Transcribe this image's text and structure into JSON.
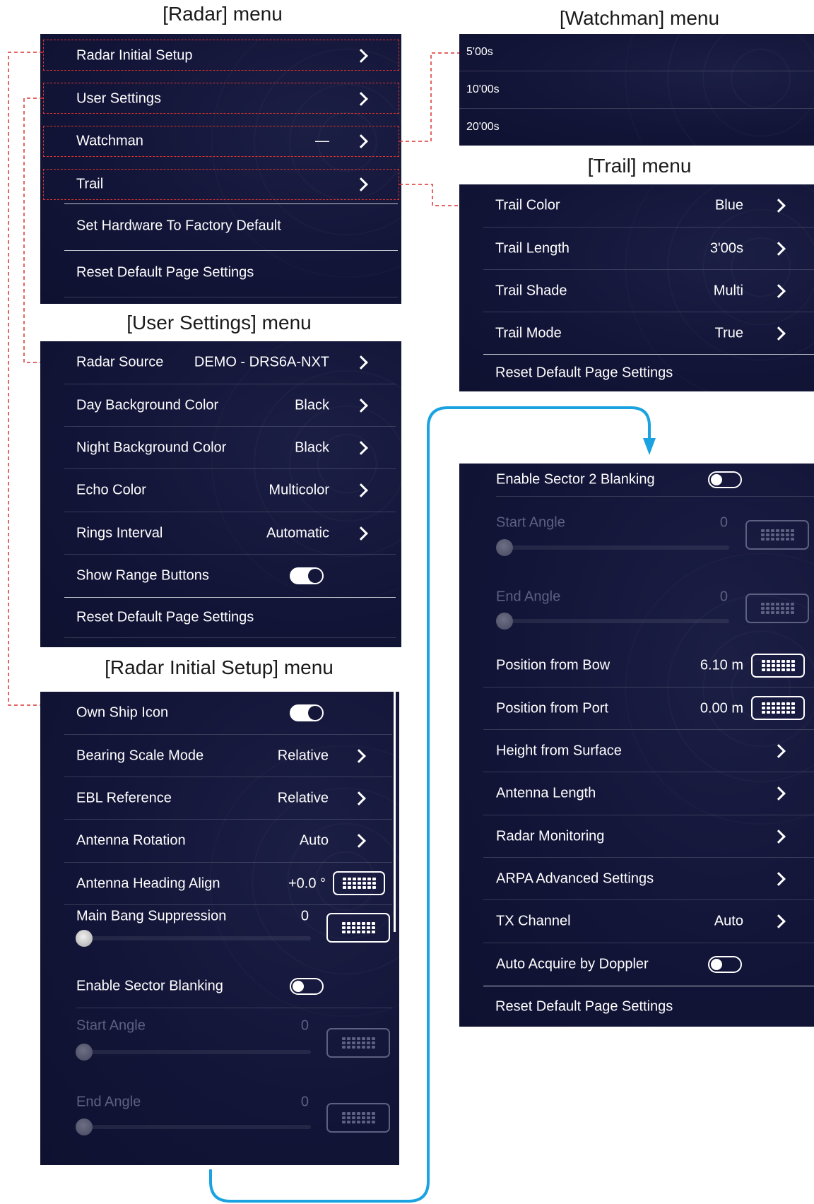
{
  "captions": {
    "radar": "[Radar] menu",
    "watchman": "[Watchman] menu",
    "trail": "[Trail] menu",
    "user_settings": "[User Settings] menu",
    "radar_initial_setup": "[Radar Initial Setup] menu"
  },
  "radar_menu": {
    "items": [
      {
        "label": "Radar Initial Setup"
      },
      {
        "label": "User Settings"
      },
      {
        "label": "Watchman",
        "value": "—"
      },
      {
        "label": "Trail"
      },
      {
        "label": "Set Hardware To Factory Default"
      },
      {
        "label": "Reset Default Page Settings"
      }
    ]
  },
  "watchman_menu": {
    "items": [
      {
        "label": "5'00s"
      },
      {
        "label": "10'00s"
      },
      {
        "label": "20'00s"
      }
    ]
  },
  "trail_menu": {
    "items": [
      {
        "label": "Trail Color",
        "value": "Blue"
      },
      {
        "label": "Trail Length",
        "value": "3'00s"
      },
      {
        "label": "Trail Shade",
        "value": "Multi"
      },
      {
        "label": "Trail Mode",
        "value": "True"
      },
      {
        "label": "Reset Default Page Settings"
      }
    ]
  },
  "user_settings_menu": {
    "items": [
      {
        "label": "Radar Source",
        "value": "DEMO - DRS6A-NXT"
      },
      {
        "label": "Day Background Color",
        "value": "Black"
      },
      {
        "label": "Night Background Color",
        "value": "Black"
      },
      {
        "label": "Echo Color",
        "value": "Multicolor"
      },
      {
        "label": "Rings Interval",
        "value": "Automatic"
      },
      {
        "label": "Show Range Buttons",
        "toggle": "on"
      },
      {
        "label": "Reset Default Page Settings"
      }
    ]
  },
  "radar_initial_setup_menu": {
    "items": [
      {
        "label": "Own Ship Icon",
        "toggle": "on"
      },
      {
        "label": "Bearing Scale Mode",
        "value": "Relative"
      },
      {
        "label": "EBL Reference",
        "value": "Relative"
      },
      {
        "label": "Antenna Rotation",
        "value": "Auto"
      },
      {
        "label": "Antenna Heading Align",
        "value": "+0.0 °"
      },
      {
        "label": "Main Bang Suppression",
        "value": "0",
        "slider": 0
      },
      {
        "label": "Enable Sector Blanking",
        "toggle": "off"
      },
      {
        "label": "Start Angle",
        "value": "0",
        "slider": 0,
        "disabled": true
      },
      {
        "label": "End Angle",
        "value": "0",
        "slider": 0,
        "disabled": true
      }
    ]
  },
  "radar_initial_setup_menu_cont": {
    "items": [
      {
        "label": "Enable Sector 2 Blanking",
        "toggle": "off"
      },
      {
        "label": "Start Angle",
        "value": "0",
        "slider": 0,
        "disabled": true
      },
      {
        "label": "End Angle",
        "value": "0",
        "slider": 0,
        "disabled": true
      },
      {
        "label": "Position from Bow",
        "value": "6.10 m"
      },
      {
        "label": "Position from Port",
        "value": "0.00 m"
      },
      {
        "label": "Height from Surface"
      },
      {
        "label": "Antenna Length"
      },
      {
        "label": "Radar Monitoring"
      },
      {
        "label": "ARPA Advanced Settings"
      },
      {
        "label": "TX Channel",
        "value": "Auto"
      },
      {
        "label": "Auto Acquire by Doppler",
        "toggle": "off"
      },
      {
        "label": "Reset Default Page Settings"
      }
    ]
  },
  "colors": {
    "panel_bg": "#14163a",
    "callout_dash": "#d8342e",
    "flow_arrow": "#1aa3e0",
    "text": "#ffffff",
    "disabled_text": "#5d6080"
  }
}
